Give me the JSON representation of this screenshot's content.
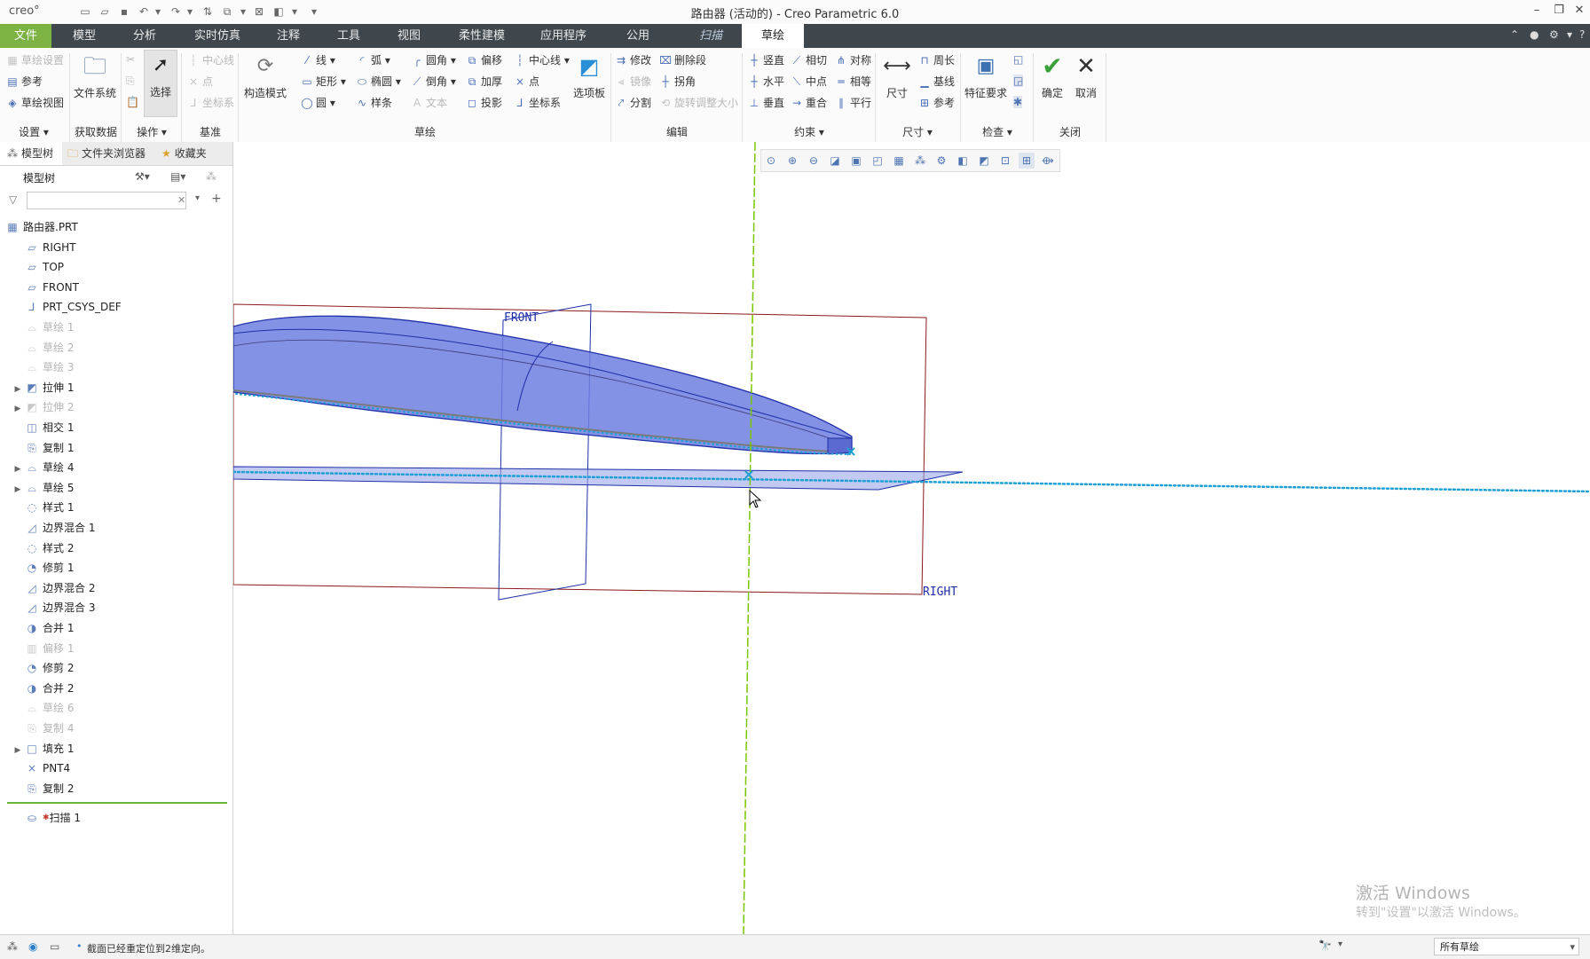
{
  "window": {
    "title": "路由器 (活动的) - Creo Parametric 6.0",
    "app_logo": "creo°"
  },
  "tabs": [
    {
      "label": "文件",
      "kind": "file"
    },
    {
      "label": "模型"
    },
    {
      "label": "分析"
    },
    {
      "label": "实时仿真"
    },
    {
      "label": "注释"
    },
    {
      "label": "工具"
    },
    {
      "label": "视图"
    },
    {
      "label": "柔性建模"
    },
    {
      "label": "应用程序"
    },
    {
      "label": "公用"
    },
    {
      "label": "扫描",
      "kind": "context"
    },
    {
      "label": "草绘",
      "kind": "selected"
    }
  ],
  "ribbon": {
    "setup": {
      "label": "设置",
      "items": [
        "草绘设置",
        "参考",
        "草绘视图"
      ]
    },
    "get_data": {
      "label": "获取数据",
      "file_system": "文件系统"
    },
    "operations": {
      "label": "操作",
      "select": "选择"
    },
    "datum": {
      "label": "基准",
      "items": [
        "中心线",
        "点",
        "坐标系"
      ]
    },
    "sketch": {
      "label": "草绘",
      "construction_mode": "构造模式",
      "col1": [
        "线",
        "矩形",
        "圆"
      ],
      "col2": [
        "弧",
        "椭圆",
        "样条"
      ],
      "col3": [
        "圆角",
        "倒角",
        "文本"
      ],
      "col4": [
        "偏移",
        "加厚",
        "投影"
      ],
      "col5": [
        "中心线",
        "点",
        "坐标系"
      ],
      "palette": "选项板"
    },
    "edit": {
      "label": "编辑",
      "col1": [
        "修改",
        "镜像",
        "分割"
      ],
      "col2": [
        "删除段",
        "拐角",
        "旋转调整大小"
      ]
    },
    "constraints": {
      "label": "约束",
      "col1": [
        "竖直",
        "水平",
        "垂直"
      ],
      "col2": [
        "相切",
        "中点",
        "重合"
      ],
      "col3": [
        "对称",
        "相等",
        "平行"
      ]
    },
    "dimension": {
      "label": "尺寸",
      "dim": "尺寸",
      "items": [
        "周长",
        "基线",
        "参考"
      ]
    },
    "inspect": {
      "label": "检查",
      "feature_req": "特征要求"
    },
    "close": {
      "label": "关闭",
      "ok": "确定",
      "cancel": "取消"
    }
  },
  "left_panel": {
    "tabs": [
      "模型树",
      "文件夹浏览器",
      "收藏夹"
    ],
    "tree_header": "模型树",
    "search_placeholder": "",
    "items": [
      {
        "label": "路由器.PRT",
        "icon": "part-icon",
        "indent": 0
      },
      {
        "label": "RIGHT",
        "icon": "datum-plane-icon",
        "indent": 1
      },
      {
        "label": "TOP",
        "icon": "datum-plane-icon",
        "indent": 1
      },
      {
        "label": "FRONT",
        "icon": "datum-plane-icon",
        "indent": 1
      },
      {
        "label": "PRT_CSYS_DEF",
        "icon": "csys-icon",
        "indent": 1
      },
      {
        "label": "草绘 1",
        "icon": "sketch-icon",
        "indent": 1,
        "disabled": true
      },
      {
        "label": "草绘 2",
        "icon": "sketch-icon",
        "indent": 1,
        "disabled": true
      },
      {
        "label": "草绘 3",
        "icon": "sketch-icon",
        "indent": 1,
        "disabled": true
      },
      {
        "label": "拉伸 1",
        "icon": "extrude-icon",
        "indent": 1,
        "expand": true
      },
      {
        "label": "拉伸 2",
        "icon": "extrude-icon",
        "indent": 1,
        "expand": true,
        "disabled": true
      },
      {
        "label": "相交 1",
        "icon": "intersect-icon",
        "indent": 1
      },
      {
        "label": "复制 1",
        "icon": "copy-icon",
        "indent": 1
      },
      {
        "label": "草绘 4",
        "icon": "sketch-icon",
        "indent": 1,
        "expand": true
      },
      {
        "label": "草绘 5",
        "icon": "sketch-icon",
        "indent": 1,
        "expand": true
      },
      {
        "label": "样式 1",
        "icon": "style-icon",
        "indent": 1
      },
      {
        "label": "边界混合 1",
        "icon": "boundary-blend-icon",
        "indent": 1
      },
      {
        "label": "样式 2",
        "icon": "style-icon",
        "indent": 1
      },
      {
        "label": "修剪 1",
        "icon": "trim-icon",
        "indent": 1
      },
      {
        "label": "边界混合 2",
        "icon": "boundary-blend-icon",
        "indent": 1
      },
      {
        "label": "边界混合 3",
        "icon": "boundary-blend-icon",
        "indent": 1
      },
      {
        "label": "合并 1",
        "icon": "merge-icon",
        "indent": 1
      },
      {
        "label": "偏移 1",
        "icon": "offset-icon",
        "indent": 1,
        "disabled": true
      },
      {
        "label": "修剪 2",
        "icon": "trim-icon",
        "indent": 1
      },
      {
        "label": "合并 2",
        "icon": "merge-icon",
        "indent": 1
      },
      {
        "label": "草绘 6",
        "icon": "sketch-icon",
        "indent": 1,
        "disabled": true
      },
      {
        "label": "复制 4",
        "icon": "copy-icon",
        "indent": 1,
        "disabled": true
      },
      {
        "label": "填充 1",
        "icon": "fill-icon",
        "indent": 1,
        "expand": true
      },
      {
        "label": "PNT4",
        "icon": "point-icon",
        "indent": 1
      },
      {
        "label": "复制 2",
        "icon": "copy-icon",
        "indent": 1
      }
    ],
    "insert_item": "扫描 1"
  },
  "canvas": {
    "labels": {
      "front": "FRONT",
      "right": "RIGHT"
    },
    "colors": {
      "surface": "#6f7fe0",
      "edge": "#1f2fa8",
      "dots": "#1e9fd6",
      "plane": "#8b1a1a",
      "axis": "#79c600"
    }
  },
  "status": {
    "message": "截面已经重定位到2维定向。",
    "filter": "所有草绘"
  },
  "watermark": {
    "line1": "激活 Windows",
    "line2": "转到\"设置\"以激活 Windows。"
  }
}
